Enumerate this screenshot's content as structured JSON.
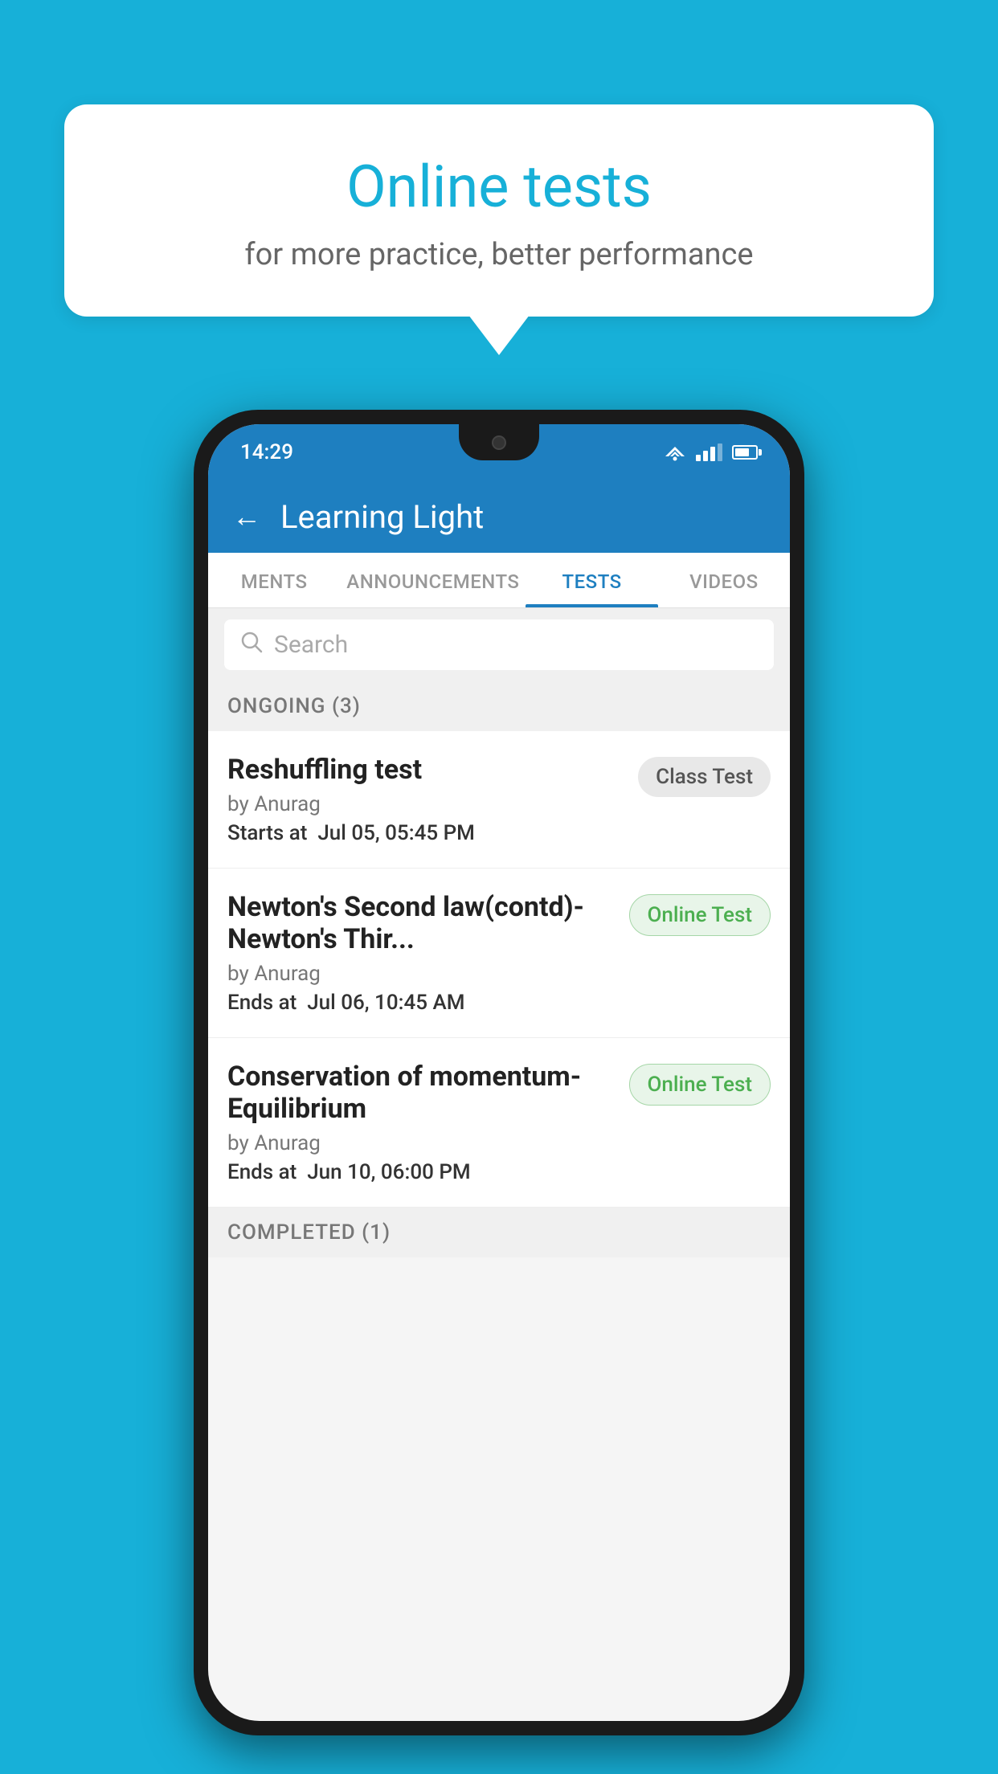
{
  "background_color": "#17b0d8",
  "speech_bubble": {
    "title": "Online tests",
    "subtitle": "for more practice, better performance"
  },
  "phone": {
    "status_bar": {
      "time": "14:29"
    },
    "header": {
      "title": "Learning Light",
      "back_label": "←"
    },
    "tabs": [
      {
        "label": "MENTS",
        "active": false
      },
      {
        "label": "ANNOUNCEMENTS",
        "active": false
      },
      {
        "label": "TESTS",
        "active": true
      },
      {
        "label": "VIDEOS",
        "active": false
      }
    ],
    "search": {
      "placeholder": "Search"
    },
    "ongoing_section": {
      "label": "ONGOING (3)"
    },
    "tests": [
      {
        "name": "Reshuffling test",
        "by": "by Anurag",
        "date_label": "Starts at",
        "date_value": "Jul 05, 05:45 PM",
        "badge": "Class Test",
        "badge_type": "class"
      },
      {
        "name": "Newton's Second law(contd)-Newton's Thir...",
        "by": "by Anurag",
        "date_label": "Ends at",
        "date_value": "Jul 06, 10:45 AM",
        "badge": "Online Test",
        "badge_type": "online"
      },
      {
        "name": "Conservation of momentum-Equilibrium",
        "by": "by Anurag",
        "date_label": "Ends at",
        "date_value": "Jun 10, 06:00 PM",
        "badge": "Online Test",
        "badge_type": "online"
      }
    ],
    "completed_section": {
      "label": "COMPLETED (1)"
    }
  }
}
